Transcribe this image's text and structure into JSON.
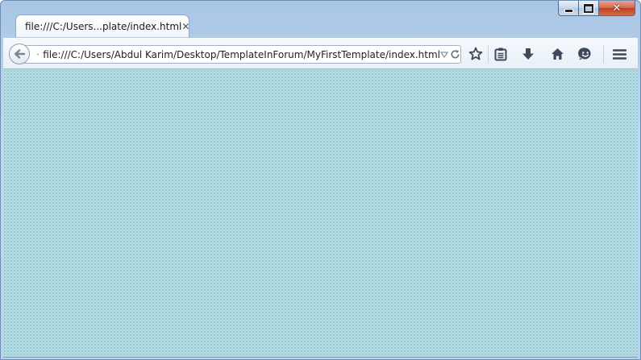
{
  "window": {
    "caption_buttons": {
      "minimize": "minimize-icon",
      "maximize": "maximize-icon",
      "close": "close-icon"
    }
  },
  "tab": {
    "title": "file:///C:/Users...plate/index.html",
    "close_glyph": "✕"
  },
  "toolbar": {
    "url": "file:///C:/Users/Abdul Karim/Desktop/TemplateInForum/MyFirstTemplate/index.html",
    "icons": [
      "back-arrow-icon",
      "globe-icon",
      "dropdown-icon",
      "reload-icon",
      "star-icon",
      "reading-list-icon",
      "download-icon",
      "home-icon",
      "hello-icon",
      "menu-icon"
    ]
  },
  "colors": {
    "page_background": "#b9e0e9",
    "toolbar_icon": "#3c4a5a",
    "close_button": "#c9492a"
  }
}
